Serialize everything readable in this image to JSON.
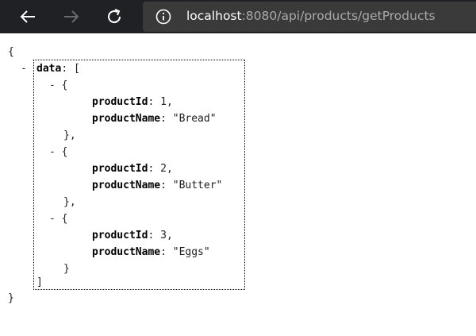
{
  "browser": {
    "url_host": "localhost",
    "url_rest": ":8080/api/products/getProducts"
  },
  "json_view": {
    "open_brace": "{",
    "close_brace": "}",
    "collapse_toggle": "-",
    "root_key": "data",
    "colon": ":",
    "open_bracket": "[",
    "close_bracket": "]",
    "item_open": "{",
    "item_close": "}",
    "item_close_comma": "},",
    "comma": ",",
    "items": [
      {
        "id_key": "productId",
        "id_value": "1",
        "name_key": "productName",
        "name_value": "\"Bread\""
      },
      {
        "id_key": "productId",
        "id_value": "2",
        "name_key": "productName",
        "name_value": "\"Butter\""
      },
      {
        "id_key": "productId",
        "id_value": "3",
        "name_key": "productName",
        "name_value": "\"Eggs\""
      }
    ]
  }
}
